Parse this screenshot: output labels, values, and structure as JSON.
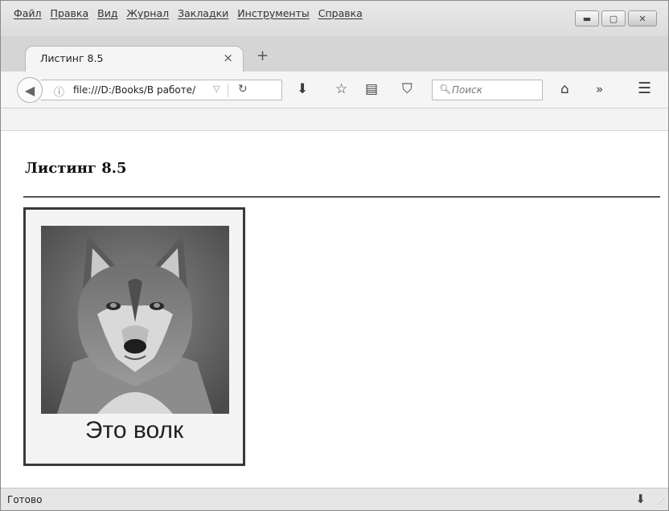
{
  "menu": [
    "Файл",
    "Правка",
    "Вид",
    "Журнал",
    "Закладки",
    "Инструменты",
    "Справка"
  ],
  "tab": {
    "title": "Листинг 8.5",
    "close": "×",
    "new": "+"
  },
  "address": {
    "url": "file:///D:/Books/В работе/"
  },
  "search": {
    "placeholder": "Поиск"
  },
  "page": {
    "heading": "Листинг 8.5",
    "caption": "Это волк"
  },
  "status": {
    "text": "Готово"
  },
  "icons": {
    "back": "back-arrow-icon",
    "info": "info-icon",
    "reload": "reload-icon",
    "download": "download-icon",
    "bookmark": "star-icon",
    "reader": "reading-list-icon",
    "pocket": "pocket-icon",
    "home": "home-icon",
    "overflow": "chevron-double-icon",
    "menu": "hamburger-icon"
  }
}
